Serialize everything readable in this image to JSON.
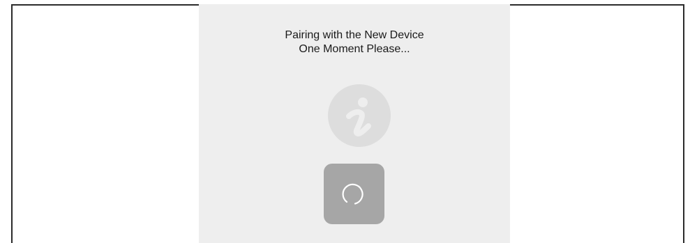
{
  "dialog": {
    "title_line1": "Pairing with the New Device",
    "title_line2": "One Moment Please..."
  },
  "icons": {
    "info": "info-icon",
    "spinner": "loading-spinner-icon"
  },
  "colors": {
    "panel_background": "#eeeeee",
    "info_circle": "#dddddd",
    "info_glyph": "#eeeeee",
    "spinner_box": "#a6a6a6",
    "spinner_ring": "#ffffff",
    "frame_border": "#2b2b2b"
  }
}
